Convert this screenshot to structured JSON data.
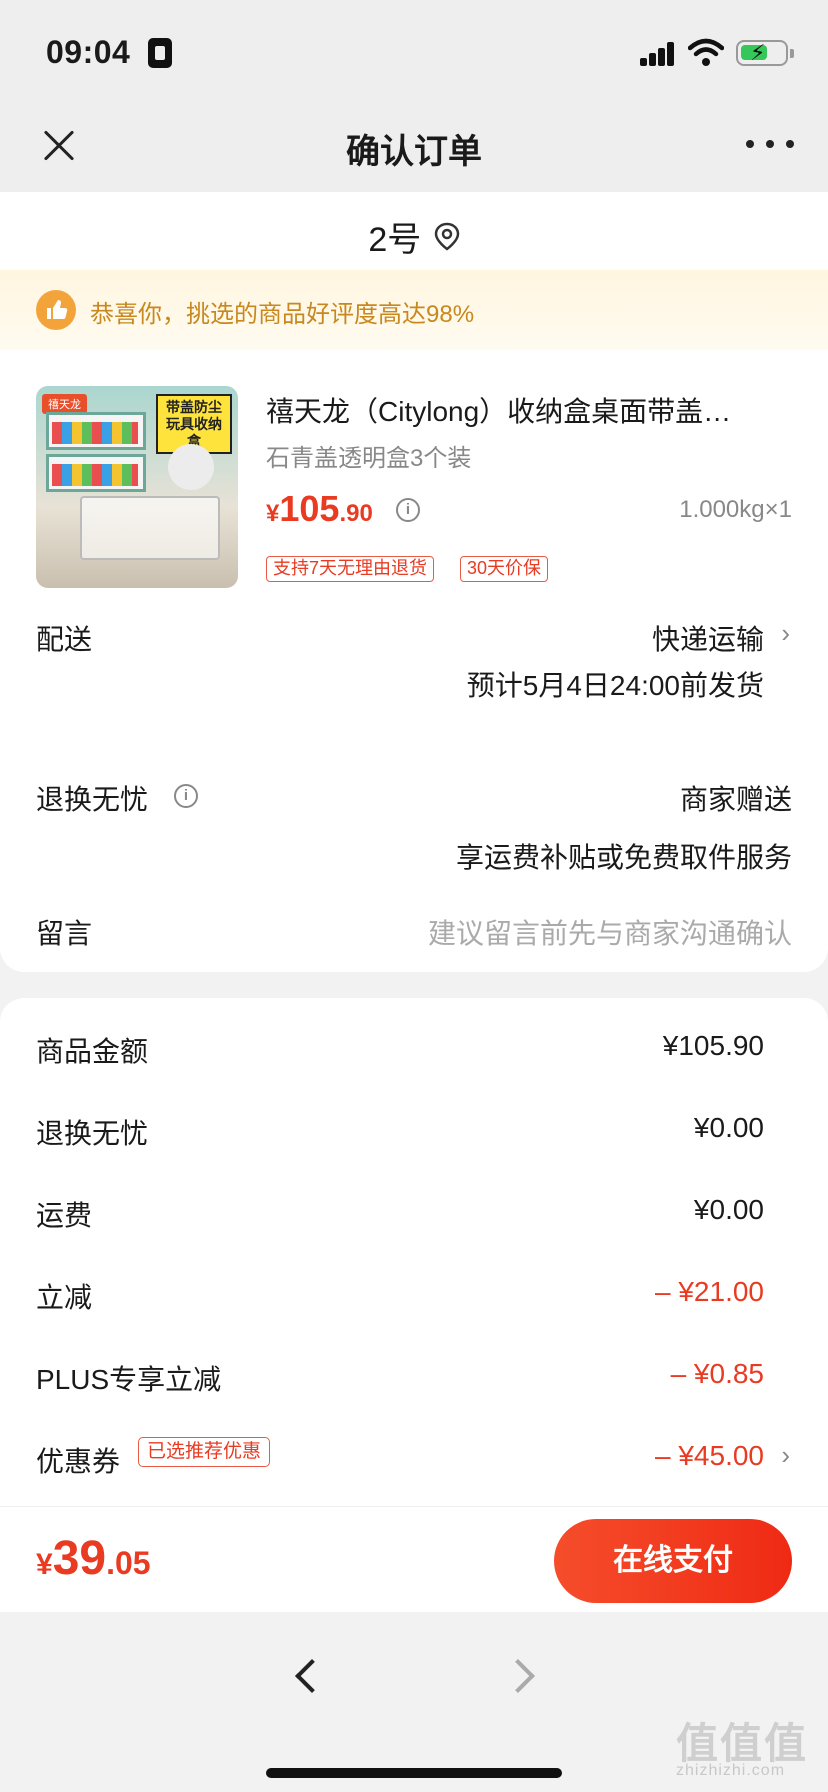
{
  "status_bar": {
    "time": "09:04"
  },
  "nav": {
    "title": "确认订单"
  },
  "address": {
    "text": "2号"
  },
  "notice": {
    "text": "恭喜你，挑选的商品好评度高达98%"
  },
  "product": {
    "image_brand": "禧天龙",
    "image_slogan": "带盖防尘 玩具收纳盒",
    "title": "禧天龙（Citylong）收纳盒桌面带盖…",
    "spec": "石青盖透明盒3个装",
    "price_symbol": "¥",
    "price_int": "105",
    "price_dec": ".90",
    "weight": "1.000kg×1",
    "tags": [
      "支持7天无理由退货",
      "30天价保"
    ]
  },
  "delivery": {
    "label": "配送",
    "method": "快递运输",
    "estimate": "预计5月4日24:00前发货"
  },
  "return_service": {
    "label": "退换无忧",
    "value": "商家赠送",
    "desc": "享运费补贴或免费取件服务"
  },
  "message": {
    "label": "留言",
    "placeholder": "建议留言前先与商家沟通确认"
  },
  "summary": {
    "goods_label": "商品金额",
    "goods_value": "¥105.90",
    "return_label": "退换无忧",
    "return_value": "¥0.00",
    "freight_label": "运费",
    "freight_value": "¥0.00",
    "direct_label": "立减",
    "direct_value": "– ¥21.00",
    "plus_label": "PLUS专享立减",
    "plus_value": "– ¥0.85",
    "coupon_label": "优惠券",
    "coupon_tag": "已选推荐优惠",
    "coupon_value": "– ¥45.00"
  },
  "pay": {
    "symbol": "¥",
    "int": "39",
    "dec": ".05",
    "button": "在线支付"
  },
  "watermark": {
    "text": "值值值",
    "sub": "zhizhizhi.com"
  },
  "colors": {
    "accent": "#e93a22",
    "notice_text": "#c8881e",
    "pay_button": "#ef2a14"
  }
}
